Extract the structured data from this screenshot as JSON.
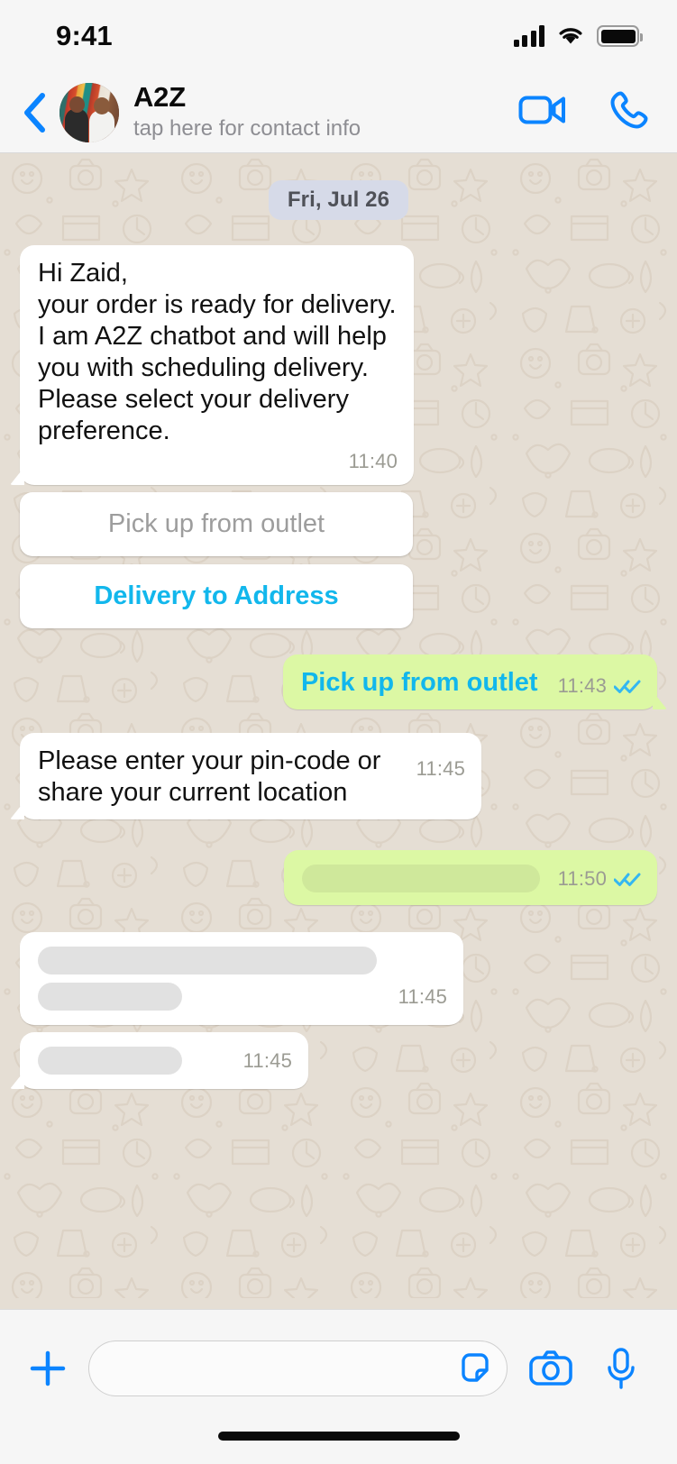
{
  "status_bar": {
    "time": "9:41",
    "signal_icon": "cellular-signal-icon",
    "wifi_icon": "wifi-icon",
    "battery_icon": "battery-full-icon"
  },
  "header": {
    "back_icon": "back-chevron-icon",
    "avatar_label": "contact-avatar",
    "title": "A2Z",
    "subtitle": "tap here for contact info",
    "video_call_icon": "video-call-icon",
    "voice_call_icon": "phone-call-icon"
  },
  "chat": {
    "date_divider": "Fri, Jul 26",
    "messages": [
      {
        "id": "msg-greeting",
        "direction": "in",
        "text": "Hi Zaid,\nyour order is ready for delivery. I am A2Z chatbot and will help you with scheduling delivery. Please select your delivery preference.",
        "time": "11:40",
        "status": ""
      },
      {
        "id": "msg-reply-pickup",
        "direction": "out",
        "text": "Pick up from outlet",
        "time": "11:43",
        "status": "read"
      },
      {
        "id": "msg-pincode-request",
        "direction": "in",
        "text": "Please enter your pin-code or share your current location",
        "time": "11:45",
        "status": ""
      },
      {
        "id": "msg-redacted-out",
        "direction": "out",
        "text": "",
        "time": "11:50",
        "status": "read",
        "redacted_bars": [
          1
        ]
      },
      {
        "id": "msg-redacted-in-1",
        "direction": "in",
        "text": "",
        "time": "11:45",
        "status": "",
        "redacted_bars": [
          1,
          2
        ]
      },
      {
        "id": "msg-redacted-in-2",
        "direction": "in",
        "text": "",
        "time": "11:45",
        "status": "",
        "redacted_bars": [
          1
        ]
      }
    ],
    "quick_replies": [
      {
        "label": "Pick up from outlet",
        "style": "muted"
      },
      {
        "label": "Delivery to Address",
        "style": "accent"
      }
    ]
  },
  "input_bar": {
    "attach_icon": "plus-icon",
    "message_value": "",
    "message_placeholder": "",
    "sticker_icon": "sticker-icon",
    "camera_icon": "camera-icon",
    "mic_icon": "microphone-icon"
  },
  "colors": {
    "accent_blue": "#12b7ec",
    "ios_blue": "#0b84ff",
    "outgoing_bubble": "#dcf8a4",
    "incoming_bubble": "#ffffff",
    "wallpaper": "#e5ded4",
    "date_pill": "#d6dae8",
    "tick_read": "#34b7f1"
  }
}
